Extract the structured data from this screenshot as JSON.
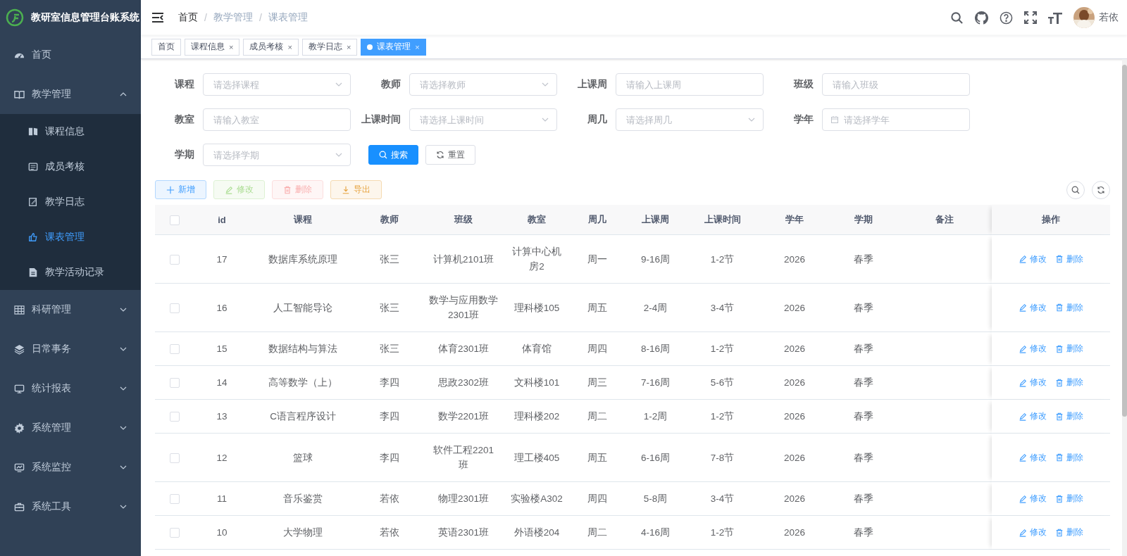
{
  "sidebar": {
    "title": "教研室信息管理台账系统",
    "items": [
      {
        "label": "首页",
        "selected": false
      },
      {
        "label": "教学管理",
        "expanded": true,
        "selected": false,
        "children": [
          {
            "label": "课程信息",
            "selected": false
          },
          {
            "label": "成员考核",
            "selected": false
          },
          {
            "label": "教学日志",
            "selected": false
          },
          {
            "label": "课表管理",
            "selected": true
          },
          {
            "label": "教学活动记录",
            "selected": false
          }
        ]
      },
      {
        "label": "科研管理",
        "expanded": false,
        "selected": false
      },
      {
        "label": "日常事务",
        "expanded": false,
        "selected": false
      },
      {
        "label": "统计报表",
        "expanded": false,
        "selected": false
      },
      {
        "label": "系统管理",
        "expanded": false,
        "selected": false
      },
      {
        "label": "系统监控",
        "expanded": false,
        "selected": false
      },
      {
        "label": "系统工具",
        "expanded": false,
        "selected": false
      }
    ]
  },
  "header": {
    "breadcrumb": {
      "separator": "/",
      "items": [
        "首页",
        "教学管理",
        "课表管理"
      ]
    },
    "user": "若依"
  },
  "tabs": [
    {
      "label": "首页",
      "selected": false
    },
    {
      "label": "课程信息",
      "selected": false,
      "close": "×"
    },
    {
      "label": "成员考核",
      "selected": false,
      "close": "×"
    },
    {
      "label": "教学日志",
      "selected": false,
      "close": "×"
    },
    {
      "label": "课表管理",
      "selected": true,
      "close": "×"
    }
  ],
  "query": {
    "fields": [
      {
        "label": "课程",
        "kind": "select",
        "placeholder": "请选择课程"
      },
      {
        "label": "教师",
        "kind": "select",
        "placeholder": "请选择教师"
      },
      {
        "label": "上课周",
        "kind": "input",
        "placeholder": "请输入上课周"
      },
      {
        "label": "班级",
        "kind": "input",
        "placeholder": "请输入班级"
      },
      {
        "label": "教室",
        "kind": "input",
        "placeholder": "请输入教室"
      },
      {
        "label": "上课时间",
        "kind": "select",
        "placeholder": "请选择上课时间"
      },
      {
        "label": "周几",
        "kind": "select",
        "placeholder": "请选择周几"
      },
      {
        "label": "学年",
        "kind": "date",
        "placeholder": "请选择学年"
      },
      {
        "label": "学期",
        "kind": "select",
        "placeholder": "请选择学期"
      }
    ],
    "search": "搜索",
    "reset": "重置"
  },
  "toolbar": [
    {
      "label": "新增",
      "kind": "add",
      "disabled": false
    },
    {
      "label": "修改",
      "kind": "edit",
      "disabled": true
    },
    {
      "label": "删除",
      "kind": "delete",
      "disabled": true
    },
    {
      "label": "导出",
      "kind": "export",
      "disabled": false
    }
  ],
  "table": {
    "all_checked": false,
    "columns": [
      "id",
      "课程",
      "教师",
      "班级",
      "教室",
      "周几",
      "上课周",
      "上课时间",
      "学年",
      "学期",
      "备注",
      "操作"
    ],
    "rows": [
      {
        "checked": false,
        "cells": [
          "17",
          "数据库系统原理",
          "张三",
          "计算机2101班",
          "计算中心机房2",
          "周一",
          "9-16周",
          "1-2节",
          "2026",
          "春季",
          ""
        ],
        "actions": [
          "修改",
          "删除"
        ]
      },
      {
        "checked": false,
        "cells": [
          "16",
          "人工智能导论",
          "张三",
          "数学与应用数学2301班",
          "理科楼105",
          "周五",
          "2-4周",
          "3-4节",
          "2026",
          "春季",
          ""
        ],
        "actions": [
          "修改",
          "删除"
        ]
      },
      {
        "checked": false,
        "cells": [
          "15",
          "数据结构与算法",
          "张三",
          "体育2301班",
          "体育馆",
          "周四",
          "8-16周",
          "1-2节",
          "2026",
          "春季",
          ""
        ],
        "actions": [
          "修改",
          "删除"
        ]
      },
      {
        "checked": false,
        "cells": [
          "14",
          "高等数学（上）",
          "李四",
          "思政2302班",
          "文科楼101",
          "周三",
          "7-16周",
          "5-6节",
          "2026",
          "春季",
          ""
        ],
        "actions": [
          "修改",
          "删除"
        ]
      },
      {
        "checked": false,
        "cells": [
          "13",
          "C语言程序设计",
          "李四",
          "数学2201班",
          "理科楼202",
          "周二",
          "1-2周",
          "1-2节",
          "2026",
          "春季",
          ""
        ],
        "actions": [
          "修改",
          "删除"
        ]
      },
      {
        "checked": false,
        "cells": [
          "12",
          "篮球",
          "李四",
          "软件工程2201班",
          "理工楼405",
          "周五",
          "6-16周",
          "7-8节",
          "2026",
          "春季",
          ""
        ],
        "actions": [
          "修改",
          "删除"
        ]
      },
      {
        "checked": false,
        "cells": [
          "11",
          "音乐鉴赏",
          "若依",
          "物理2301班",
          "实验楼A302",
          "周四",
          "5-8周",
          "3-4节",
          "2026",
          "春季",
          ""
        ],
        "actions": [
          "修改",
          "删除"
        ]
      },
      {
        "checked": false,
        "cells": [
          "10",
          "大学物理",
          "若依",
          "英语2301班",
          "外语楼204",
          "周二",
          "4-16周",
          "1-2节",
          "2026",
          "春季",
          ""
        ],
        "actions": [
          "修改",
          "删除"
        ]
      }
    ]
  }
}
